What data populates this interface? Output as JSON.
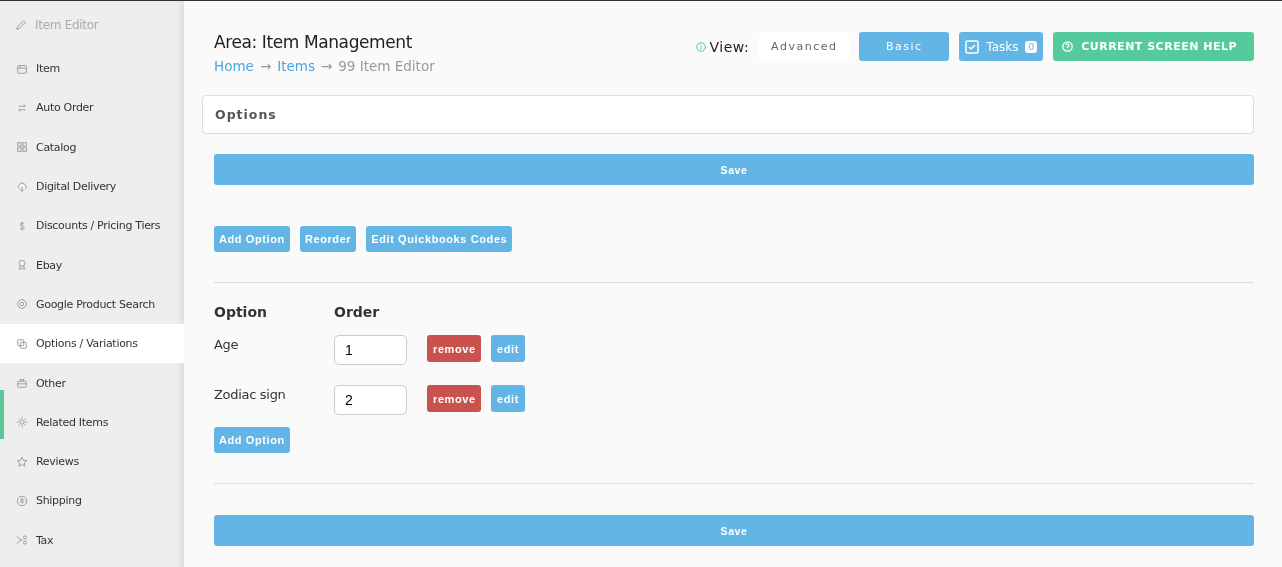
{
  "sidebar": {
    "header": "Item Editor",
    "items": [
      {
        "label": "Item",
        "selected": false
      },
      {
        "label": "Auto Order",
        "selected": false
      },
      {
        "label": "Catalog",
        "selected": false
      },
      {
        "label": "Digital Delivery",
        "selected": false
      },
      {
        "label": "Discounts / Pricing Tiers",
        "selected": false
      },
      {
        "label": "Ebay",
        "selected": false
      },
      {
        "label": "Google Product Search",
        "selected": false
      },
      {
        "label": "Options / Variations",
        "selected": true
      },
      {
        "label": "Other",
        "selected": false
      },
      {
        "label": "Related Items",
        "selected": false
      },
      {
        "label": "Reviews",
        "selected": false
      },
      {
        "label": "Shipping",
        "selected": false
      },
      {
        "label": "Tax",
        "selected": false
      }
    ]
  },
  "header": {
    "title": "Area: Item Management",
    "breadcrumb": [
      {
        "label": "Home",
        "kind": "link"
      },
      {
        "label": "→",
        "kind": "separator"
      },
      {
        "label": "Items",
        "kind": "link"
      },
      {
        "label": "→",
        "kind": "separator"
      },
      {
        "label": "99 Item Editor",
        "kind": "current"
      }
    ],
    "view_label": "View:",
    "views": [
      {
        "label": "Advanced",
        "selected": false
      },
      {
        "label": "Basic",
        "selected": true
      }
    ],
    "tasks": {
      "label": "Tasks",
      "count": "0"
    },
    "help": "CURRENT SCREEN HELP"
  },
  "panel_title": "Options",
  "save": "Save",
  "actions": [
    "Add Option",
    "Reorder",
    "Edit Quickbooks Codes"
  ],
  "table": {
    "columns": [
      "Option",
      "Order"
    ],
    "rows": [
      {
        "option": "Age",
        "order": "1",
        "remove": "remove",
        "edit": "edit"
      },
      {
        "option": "Zodiac sign",
        "order": "2",
        "remove": "remove",
        "edit": "edit"
      }
    ]
  },
  "add_option": "Add Option",
  "save_bottom": "Save"
}
